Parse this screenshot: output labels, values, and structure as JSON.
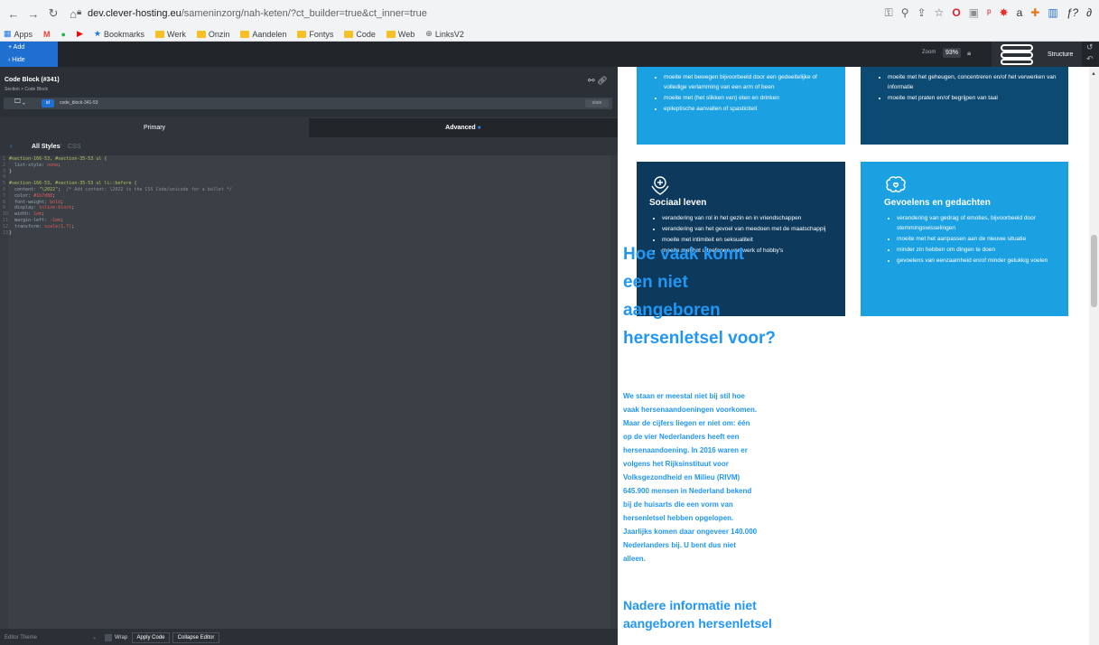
{
  "browser": {
    "url_host": "dev.clever-hosting.eu",
    "url_path": "/sameninzorg/nah-keten/?ct_builder=true&ct_inner=true",
    "bookmarks": [
      {
        "label": "Apps",
        "type": "apps"
      },
      {
        "label": "Bookmarks",
        "type": "star"
      },
      {
        "label": "Werk",
        "type": "folder"
      },
      {
        "label": "Onzin",
        "type": "folder"
      },
      {
        "label": "Aandelen",
        "type": "folder"
      },
      {
        "label": "Fontys",
        "type": "folder"
      },
      {
        "label": "Code",
        "type": "folder"
      },
      {
        "label": "Web",
        "type": "folder"
      },
      {
        "label": "LinksV2",
        "type": "globe"
      }
    ]
  },
  "builder": {
    "add_label": "+ Add",
    "hide_label": "‹ Hide",
    "zoom_label": "Zoom",
    "zoom_value": "93%",
    "structure_label": "Structure"
  },
  "panel": {
    "title": "Code Block (#341)",
    "subtitle": "Section > Code Block",
    "selector_id": "id",
    "selector_name": "code_block-341-53",
    "state_label": "state",
    "tab_primary": "Primary",
    "tab_advanced": "Advanced",
    "tab_advanced_dot": "●",
    "crumb_all": "All Styles",
    "crumb_sep": "/",
    "crumb_css": "CSS"
  },
  "code_lines": [
    {
      "n": "1",
      "parts": [
        {
          "c": "sel",
          "t": "#section-166-53, #section-35-53 ul {"
        }
      ]
    },
    {
      "n": "2",
      "parts": [
        {
          "c": "prop",
          "t": "  list-style: "
        },
        {
          "c": "val",
          "t": "none"
        },
        {
          "c": "",
          "t": ";"
        }
      ]
    },
    {
      "n": "3",
      "parts": [
        {
          "c": "",
          "t": "}"
        }
      ]
    },
    {
      "n": "4",
      "parts": [
        {
          "c": "",
          "t": ""
        }
      ]
    },
    {
      "n": "5",
      "parts": [
        {
          "c": "sel",
          "t": "#section-166-53, #section-35-53 ul li::before {"
        }
      ]
    },
    {
      "n": "6",
      "parts": [
        {
          "c": "prop",
          "t": "  content: "
        },
        {
          "c": "sel",
          "t": "\"\\2022\""
        },
        {
          "c": "",
          "t": ";  "
        },
        {
          "c": "cmt",
          "t": "/* Add content: \\2022 is the CSS Code/unicode for a bullet */"
        }
      ]
    },
    {
      "n": "7",
      "parts": [
        {
          "c": "prop",
          "t": "  color: "
        },
        {
          "c": "val",
          "t": "#1b7d88"
        },
        {
          "c": "",
          "t": ";"
        }
      ]
    },
    {
      "n": "8",
      "parts": [
        {
          "c": "prop",
          "t": "  font-weight: "
        },
        {
          "c": "val",
          "t": "bold"
        },
        {
          "c": "",
          "t": ";"
        }
      ]
    },
    {
      "n": "9",
      "parts": [
        {
          "c": "prop",
          "t": "  display: "
        },
        {
          "c": "val",
          "t": "inline-block"
        },
        {
          "c": "",
          "t": ";"
        }
      ]
    },
    {
      "n": "10",
      "parts": [
        {
          "c": "prop",
          "t": "  width: "
        },
        {
          "c": "val",
          "t": "1em"
        },
        {
          "c": "",
          "t": ";"
        }
      ]
    },
    {
      "n": "11",
      "parts": [
        {
          "c": "prop",
          "t": "  margin-left: "
        },
        {
          "c": "val",
          "t": "-1em"
        },
        {
          "c": "",
          "t": ";"
        }
      ]
    },
    {
      "n": "12",
      "parts": [
        {
          "c": "prop",
          "t": "  transform: "
        },
        {
          "c": "val",
          "t": "scale(1.7)"
        },
        {
          "c": "",
          "t": ";"
        }
      ]
    },
    {
      "n": "13",
      "parts": [
        {
          "c": "",
          "t": "}"
        }
      ]
    }
  ],
  "bottom": {
    "theme_label": "Editor Theme",
    "wrap_label": "Wrap",
    "apply_label": "Apply Code",
    "collapse_label": "Collapse Editor"
  },
  "cards": [
    {
      "key": "top-left",
      "heading": "",
      "bg": "#1ba1e2",
      "items": [
        "moeite met bewegen bijvoorbeeld door een gedeeltelijke of volledige verlamming van een arm of been",
        "moeite met (het slikken van) eten en drinken",
        "epileptische aanvallen of spasticiteit"
      ]
    },
    {
      "key": "top-right",
      "heading": "",
      "bg": "#0d4a73",
      "items": [
        "moeite met het geheugen, concentreren en/of het verwerken van informatie",
        "moeite met praten en/of begrijpen van taal"
      ]
    },
    {
      "key": "bottom-left",
      "heading": "Sociaal leven",
      "bg": "#0d3a5c",
      "items": [
        "verandering van rol in het gezin en in vriendschappen",
        "verandering van het gevoel van meedoen met de maatschappij",
        "moeite met intimiteit en seksualiteit",
        "moeite met het uitoefenen van werk of hobby's"
      ]
    },
    {
      "key": "bottom-right",
      "heading": "Gevoelens en gedachten",
      "bg": "#1ba1e2",
      "items": [
        "verandering van gedrag of emoties, bijvoorbeeld door stemmingswisselingen",
        "moeite met het aanpassen aan de nieuwe situatie",
        "minder zin hebben om dingen te doen",
        "gevoelens van eenzaamheid en/of minder gelukkig voelen"
      ]
    }
  ],
  "article": {
    "heading": "Hoe vaak komt een niet aangeboren hersenletsel voor?",
    "paragraph": "We staan er meestal niet bij stil hoe vaak hersenaandoeningen voorkomen. Maar de cijfers liegen er niet om: één op de vier Nederlanders heeft een hersenaandoening. In 2016 waren er volgens het Rijksinstituut voor Volksgezondheid en Milieu (RIVM) 645.900 mensen in Nederland bekend bij de huisarts die een vorm van hersenletsel hebben opgelopen. Jaarlijks komen daar ongeveer 140.000 Nederlanders bij. U bent dus niet alleen.",
    "heading2": "Nadere informatie niet aangeboren hersenletsel"
  },
  "colors": {
    "accent": "#2196f3",
    "builder_blue": "#1f6fd1",
    "panel_dark": "#33393f"
  }
}
